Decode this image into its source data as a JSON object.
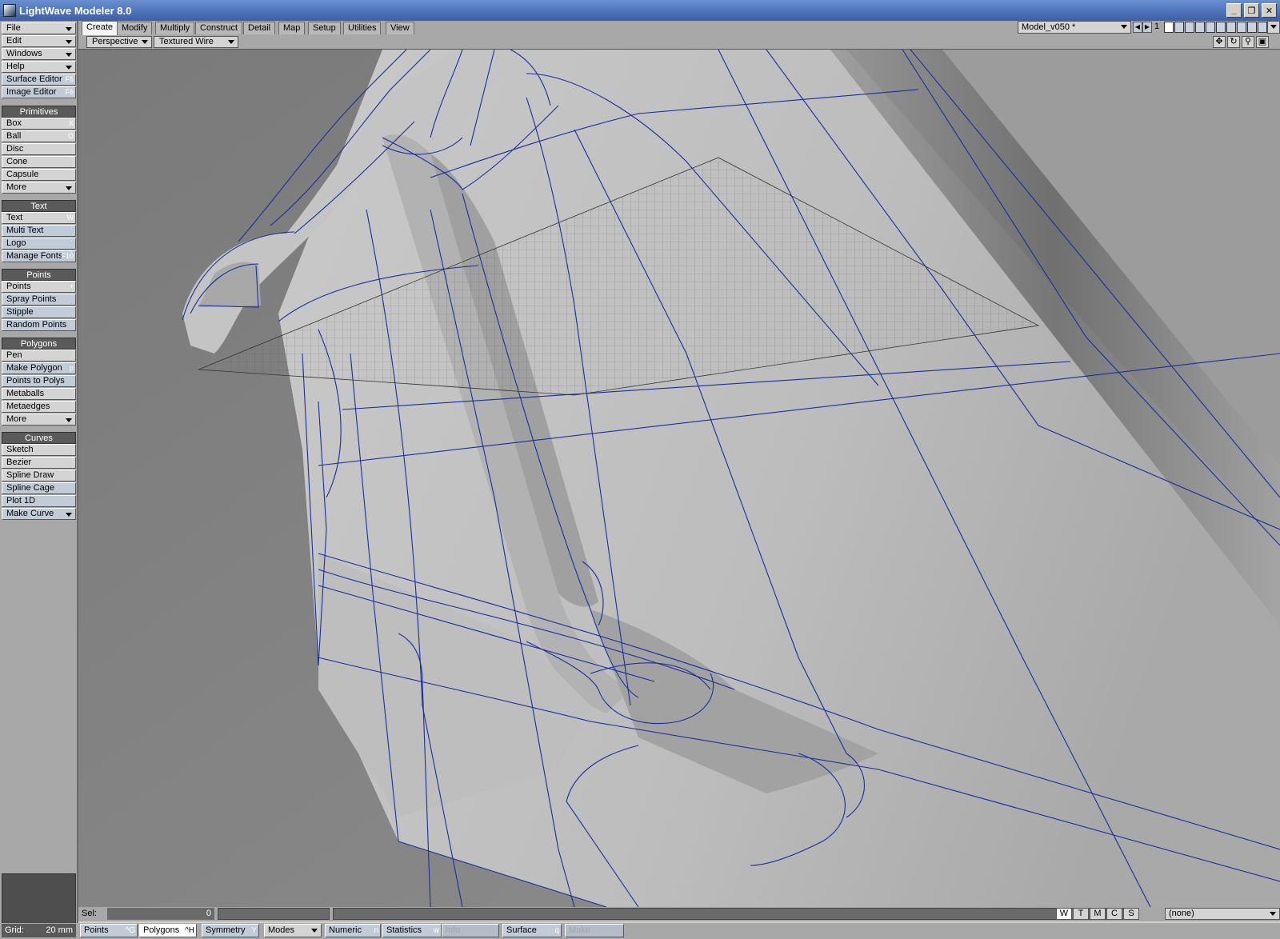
{
  "window": {
    "title": "LightWave Modeler 8.0",
    "buttons": [
      "_",
      "❐",
      "✕"
    ]
  },
  "menu": {
    "items": [
      {
        "label": "File",
        "dropdown": true
      },
      {
        "label": "Edit",
        "dropdown": true
      },
      {
        "label": "Windows",
        "dropdown": true
      },
      {
        "label": "Help",
        "dropdown": true
      },
      {
        "label": "Surface Editor",
        "shortcut": "F5"
      },
      {
        "label": "Image Editor",
        "shortcut": "F6"
      }
    ]
  },
  "groups": [
    {
      "title": "Primitives",
      "items": [
        {
          "label": "Box",
          "shortcut": "X"
        },
        {
          "label": "Ball",
          "shortcut": "O"
        },
        {
          "label": "Disc",
          "shortcut": ""
        },
        {
          "label": "Cone",
          "shortcut": ""
        },
        {
          "label": "Capsule",
          "shortcut": ""
        },
        {
          "label": "More",
          "dropdown": true
        }
      ]
    },
    {
      "title": "Text",
      "items": [
        {
          "label": "Text",
          "shortcut": "W"
        },
        {
          "label": "Multi Text",
          "shortcut": ""
        },
        {
          "label": "Logo",
          "shortcut": ""
        },
        {
          "label": "Manage Fonts",
          "shortcut": "F10"
        }
      ]
    },
    {
      "title": "Points",
      "items": [
        {
          "label": "Points",
          "shortcut": "+"
        },
        {
          "label": "Spray Points",
          "shortcut": ""
        },
        {
          "label": "Stipple",
          "shortcut": ""
        },
        {
          "label": "Random Points",
          "shortcut": ""
        }
      ]
    },
    {
      "title": "Polygons",
      "items": [
        {
          "label": "Pen",
          "shortcut": ""
        },
        {
          "label": "Make Polygon",
          "shortcut": "p"
        },
        {
          "label": "Points to Polys",
          "shortcut": ""
        },
        {
          "label": "Metaballs",
          "shortcut": ""
        },
        {
          "label": "Metaedges",
          "shortcut": ""
        },
        {
          "label": "More",
          "dropdown": true
        }
      ]
    },
    {
      "title": "Curves",
      "items": [
        {
          "label": "Sketch",
          "shortcut": ""
        },
        {
          "label": "Bezier",
          "shortcut": ""
        },
        {
          "label": "Spline Draw",
          "shortcut": ""
        },
        {
          "label": "Spline Cage",
          "shortcut": ""
        },
        {
          "label": "Plot 1D",
          "shortcut": ""
        },
        {
          "label": "Make Curve",
          "dropdown": true
        }
      ]
    }
  ],
  "tabs": [
    "Create",
    "Modify",
    "Multiply",
    "Construct",
    "Detail",
    "Map",
    "Setup",
    "Utilities",
    "View"
  ],
  "active_tab": "Create",
  "model": {
    "name": "Model_v050 *",
    "layer_number": "1"
  },
  "viewport": {
    "view_mode": "Perspective",
    "render_mode": "Textured Wire"
  },
  "status": {
    "sel_label": "Sel:",
    "sel_value": "0",
    "wtmcs": [
      "W",
      "T",
      "M",
      "C",
      "S"
    ],
    "surface_value": "(none)"
  },
  "bottom": {
    "grid_label": "Grid:",
    "grid_value": "20 mm",
    "buttons": [
      {
        "label": "Points",
        "shortcut": "^G"
      },
      {
        "label": "Polygons",
        "shortcut": "^H"
      },
      {
        "label": "Symmetry",
        "shortcut": "Y"
      },
      {
        "label": "Modes",
        "dropdown": true
      },
      {
        "label": "Numeric",
        "shortcut": "n"
      },
      {
        "label": "Statistics",
        "shortcut": "w"
      },
      {
        "label": "Info",
        "shortcut": ""
      },
      {
        "label": "Surface",
        "shortcut": "q"
      },
      {
        "label": "Make",
        "shortcut": ""
      }
    ]
  },
  "colors": {
    "wire": "#1a2f9a",
    "surface": "#bdbdbd",
    "background": "#888888"
  }
}
